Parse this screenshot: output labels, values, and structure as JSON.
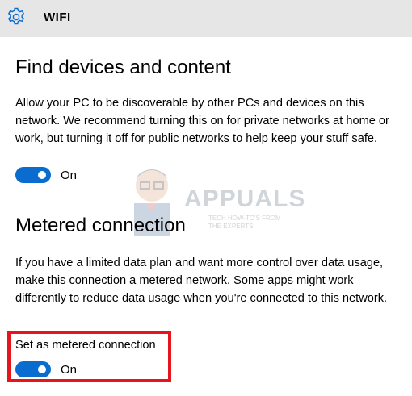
{
  "header": {
    "title": "WIFI",
    "icon": "gear-icon"
  },
  "find_devices": {
    "heading": "Find devices and content",
    "description": "Allow your PC to be discoverable by other PCs and devices on this network. We recommend turning this on for private networks at home or work, but turning it off for public networks to help keep your stuff safe.",
    "toggle_state": "On"
  },
  "metered": {
    "heading": "Metered connection",
    "description": "If you have a limited data plan and want more control over data usage, make this connection a metered network. Some apps might work differently to reduce data usage when you're connected to this network.",
    "setting_label": "Set as metered connection",
    "toggle_state": "On"
  },
  "watermark": {
    "brand": "APPUALS",
    "tagline": "TECH HOW-TO'S FROM THE EXPERTS!"
  },
  "colors": {
    "accent": "#0b6ccf",
    "titlebar": "#e6e6e6",
    "highlight": "#e8141c"
  }
}
